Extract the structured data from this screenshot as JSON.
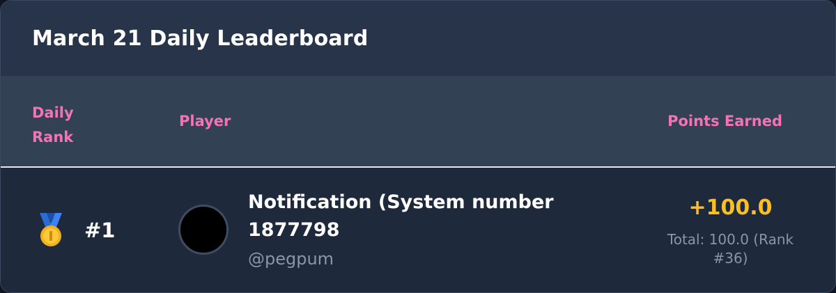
{
  "title": "March 21 Daily Leaderboard",
  "columns": {
    "rank": "Daily Rank",
    "player": "Player",
    "points": "Points Earned"
  },
  "entries": [
    {
      "medal_icon": "gold-medal-icon",
      "rank": "#1",
      "avatar_color": "#000000",
      "name": "Notification (System number 1877798",
      "handle": "@pegpum",
      "points": "+100.0",
      "total": "Total: 100.0 (Rank #36)"
    }
  ],
  "colors": {
    "header_text": "#f472b6",
    "points": "#fbbf24"
  }
}
